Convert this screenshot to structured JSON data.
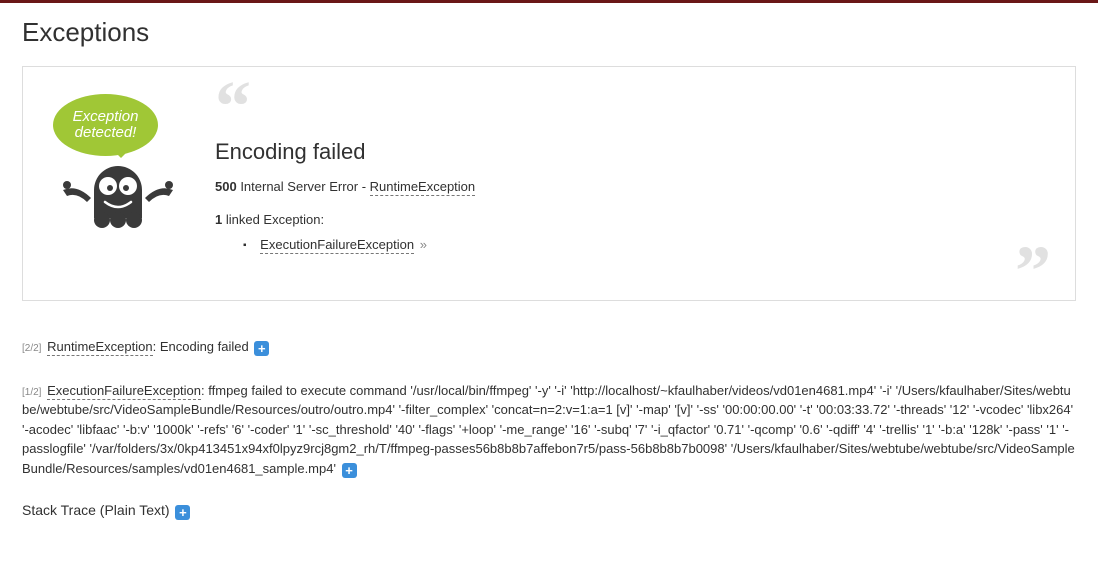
{
  "page_title": "Exceptions",
  "bubble_text": "Exception detected!",
  "box": {
    "headline": "Encoding failed",
    "status_code": "500",
    "status_text": " Internal Server Error - ",
    "exception_class": "RuntimeException",
    "linked_count": "1",
    "linked_label": " linked Exception:",
    "linked_items": [
      {
        "name": "ExecutionFailureException",
        "chev": "»"
      }
    ]
  },
  "traces": [
    {
      "counter": "[2/2]",
      "class": "RuntimeException",
      "sep": ": ",
      "message": "Encoding failed "
    },
    {
      "counter": "[1/2]",
      "class": "ExecutionFailureException",
      "sep": ": ",
      "message": "ffmpeg failed to execute command '/usr/local/bin/ffmpeg' '-y' '-i' 'http://localhost/~kfaulhaber/videos/vd01en4681.mp4' '-i' '/Users/kfaulhaber/Sites/webtube/webtube/src/VideoSampleBundle/Resources/outro/outro.mp4' '-filter_complex' 'concat=n=2:v=1:a=1 [v]' '-map' '[v]' '-ss' '00:00:00.00' '-t' '00:03:33.72' '-threads' '12' '-vcodec' 'libx264' '-acodec' 'libfaac' '-b:v' '1000k' '-refs' '6' '-coder' '1' '-sc_threshold' '40' '-flags' '+loop' '-me_range' '16' '-subq' '7' '-i_qfactor' '0.71' '-qcomp' '0.6' '-qdiff' '4' '-trellis' '1' '-b:a' '128k' '-pass' '1' '-passlogfile' '/var/folders/3x/0kp413451x94xf0lpyz9rcj8gm2_rh/T/ffmpeg-passes56b8b8b7affebon7r5/pass-56b8b8b7b0098' '/Users/kfaulhaber/Sites/webtube/webtube/src/VideoSampleBundle/Resources/samples/vd01en4681_sample.mp4' "
    }
  ],
  "stack_trace_label": "Stack Trace (Plain Text) "
}
